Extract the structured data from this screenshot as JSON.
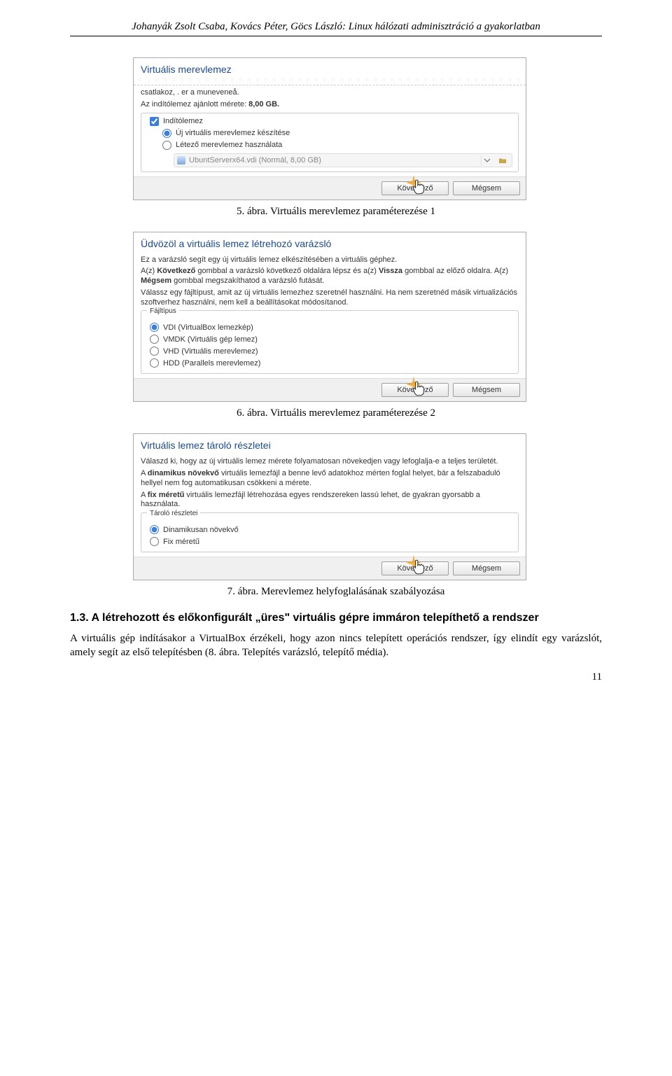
{
  "header": "Johanyák Zsolt Csaba, Kovács Péter, Göcs László: Linux hálózati adminisztráció a gyakorlatban",
  "dlg1": {
    "title": "Virtuális merevlemez",
    "line_trunc": "csatlakoz,   . er a muneveneå.",
    "rec_prefix": "Az indítólemez ajánlott mérete: ",
    "rec_val": "8,00 GB.",
    "fs_legend": "",
    "chk_label": "Indítólemez",
    "opt_new": "Új virtuális merevlemez készítése",
    "opt_exist": "Létező merevlemez használata",
    "disk_label": "UbuntServerx64.vdi (Normál, 8,00 GB)",
    "btn_next": "Következő",
    "btn_cancel": "Mégsem",
    "caption": "5. ábra. Virtuális merevlemez paraméterezése 1"
  },
  "dlg2": {
    "title": "Üdvözöl a virtuális lemez létrehozó varázsló",
    "p1": "Ez a varázsló segít egy új virtuális lemez elkészítésében a virtuális géphez.",
    "p2a": "A(z) ",
    "p2b": "Következő",
    "p2c": " gombbal a varázsló következő oldalára lépsz és a(z) ",
    "p2d": "Vissza",
    "p2e": " gombbal az előző oldalra. A(z) ",
    "p2f": "Mégsem",
    "p2g": " gombbal megszakíthatod a varázsló futását.",
    "p3": "Válassz egy fájltípust, amit az új virtuális lemezhez szeretnél használni. Ha nem szeretnéd másik virtualizációs szoftverhez használni, nem kell a beállításokat módosítanod.",
    "fs_legend": "Fájltípus",
    "opt_vdi": "VDI (VirtualBox lemezkép)",
    "opt_vmdk": "VMDK (Virtuális gép lemez)",
    "opt_vhd": "VHD (Virtuális merevlemez)",
    "opt_hdd": "HDD (Parallels merevlemez)",
    "btn_next": "Következő",
    "btn_cancel": "Mégsem",
    "caption": "6. ábra. Virtuális merevlemez paraméterezése 2"
  },
  "dlg3": {
    "title": "Virtuális lemez tároló részletei",
    "p1": "Válaszd ki, hogy az új virtuális lemez mérete folyamatosan növekedjen vagy lefoglalja-e a teljes területét.",
    "p2a": "A ",
    "p2b": "dinamikus növekvő",
    "p2c": " virtuális lemezfájl a benne levő adatokhoz mérten foglal helyet, bár a felszabaduló hellyel nem fog automatikusan csökkeni a mérete.",
    "p3a": "A ",
    "p3b": "fix méretű",
    "p3c": " virtuális lemezfájl létrehozása egyes rendszereken lassú lehet, de gyakran gyorsabb a használata.",
    "fs_legend": "Tároló részletei",
    "opt_dyn": "Dinamikusan növekvő",
    "opt_fix": "Fix méretű",
    "btn_next": "Következő",
    "btn_cancel": "Mégsem",
    "caption": "7. ábra. Merevlemez helyfoglalásának szabályozása"
  },
  "section": {
    "num": "1.3.",
    "title": "A létrehozott és előkonfigurált „üres\" virtuális gépre immáron telepíthető a rendszer",
    "para": "A virtuális gép indításakor a VirtualBox érzékeli, hogy azon nincs telepített operációs rendszer, így elindít egy varázslót, amely segít az első telepítésben (8. ábra. Telepítés varázsló, telepítő média)."
  },
  "page_number": "11"
}
